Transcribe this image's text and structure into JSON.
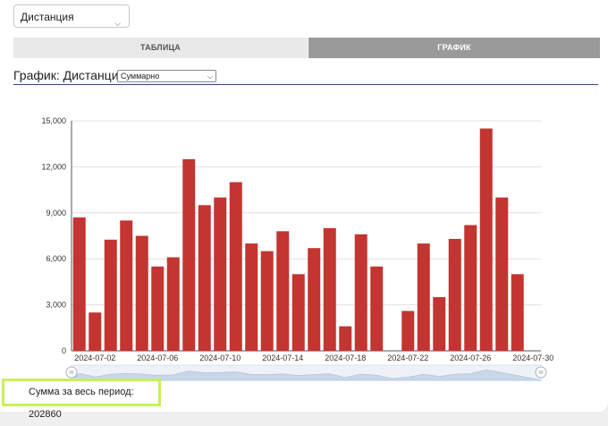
{
  "metric_select": {
    "value": "Дистанция"
  },
  "tabs": [
    {
      "label": "ТАБЛИЦА",
      "active": false
    },
    {
      "label": "ГРАФИК",
      "active": true
    }
  ],
  "chart_header": {
    "title": "График: Дистанция",
    "mode_select": {
      "value": "Суммарно"
    }
  },
  "total": {
    "text": "Сумма за весь период: 202860"
  },
  "colors": {
    "bar": "#c23531",
    "active_tab": "#9a9a9a",
    "highlight_border": "#c8f05a"
  },
  "chart_data": {
    "type": "bar",
    "x": [
      "2024-07-01",
      "2024-07-02",
      "2024-07-03",
      "2024-07-04",
      "2024-07-05",
      "2024-07-06",
      "2024-07-07",
      "2024-07-08",
      "2024-07-09",
      "2024-07-10",
      "2024-07-11",
      "2024-07-12",
      "2024-07-13",
      "2024-07-14",
      "2024-07-15",
      "2024-07-16",
      "2024-07-17",
      "2024-07-18",
      "2024-07-19",
      "2024-07-20",
      "2024-07-21",
      "2024-07-22",
      "2024-07-23",
      "2024-07-24",
      "2024-07-25",
      "2024-07-26",
      "2024-07-27",
      "2024-07-28",
      "2024-07-29",
      "2024-07-30"
    ],
    "values": [
      8700,
      2500,
      7250,
      8500,
      7500,
      5500,
      6100,
      12500,
      9500,
      10000,
      11000,
      7000,
      6500,
      7800,
      5000,
      6700,
      8000,
      1600,
      7600,
      5500,
      0,
      2600,
      7000,
      3500,
      7300,
      8200,
      14500,
      10000,
      5000,
      0
    ],
    "x_tick_labels": [
      "2024-07-02",
      "2024-07-06",
      "2024-07-10",
      "2024-07-14",
      "2024-07-18",
      "2024-07-22",
      "2024-07-26",
      "2024-07-30"
    ],
    "y_ticks": [
      "0",
      "3,000",
      "6,000",
      "9,000",
      "12,000",
      "15,000"
    ],
    "ylim": [
      0,
      15000
    ],
    "grid": true,
    "data_zoom": true
  }
}
